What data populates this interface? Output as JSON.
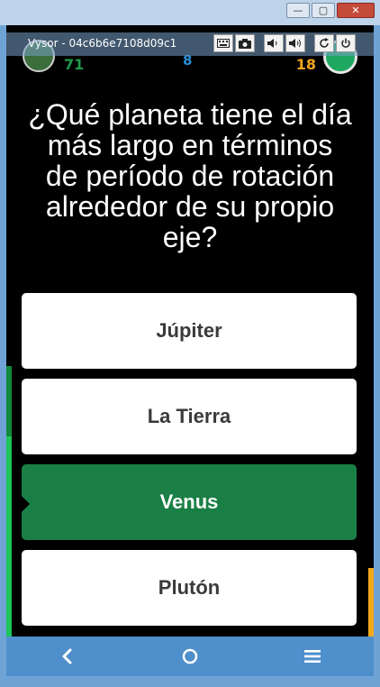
{
  "window": {
    "controls": {
      "minimize": "—",
      "maximize": "▢",
      "close": "✕"
    }
  },
  "vysor": {
    "title": "Vysor - 04c6b6e7108d09c1",
    "tools": [
      "keyboard-icon",
      "camera-icon",
      "volume-down-icon",
      "volume-up-icon",
      "rotate-icon",
      "power-icon"
    ]
  },
  "hud": {
    "score_left": "71",
    "round": "8",
    "score_right": "18"
  },
  "question": "¿Qué planeta tiene el día más largo en términos de período de rotación alrededor de su propio eje?",
  "answers": [
    {
      "label": "Júpiter",
      "selected": false
    },
    {
      "label": "La Tierra",
      "selected": false
    },
    {
      "label": "Venus",
      "selected": true
    },
    {
      "label": "Plutón",
      "selected": false
    }
  ],
  "navbar": {
    "icons": [
      "back-icon",
      "home-icon",
      "menu-icon"
    ]
  },
  "colors": {
    "selected_answer": "#1a7f45",
    "progress_left": "#1fc45a",
    "progress_right": "#f7a81b",
    "navbar": "#4f8fcc"
  }
}
